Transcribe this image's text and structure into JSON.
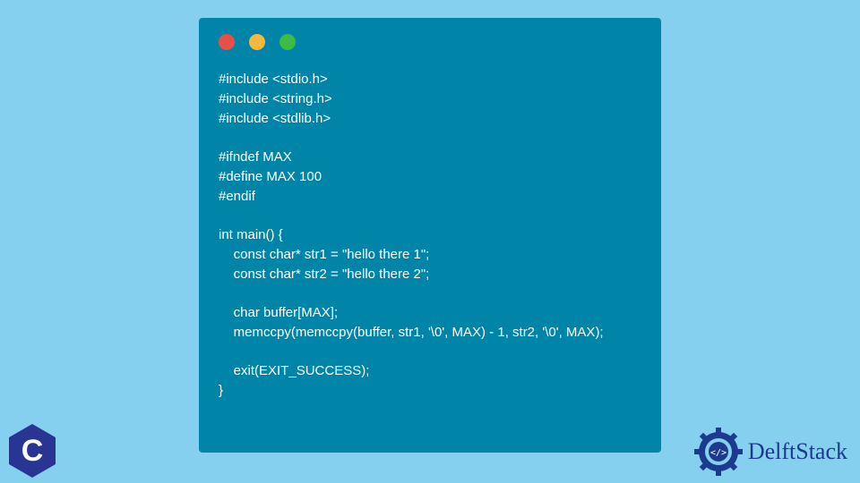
{
  "window": {
    "lights": {
      "red": "#e94f4a",
      "yellow": "#f5b83d",
      "green": "#3cbb45"
    }
  },
  "code": "#include <stdio.h>\n#include <string.h>\n#include <stdlib.h>\n\n#ifndef MAX\n#define MAX 100\n#endif\n\nint main() {\n    const char* str1 = \"hello there 1\";\n    const char* str2 = \"hello there 2\";\n\n    char buffer[MAX];\n    memccpy(memccpy(buffer, str1, '\\0', MAX) - 1, str2, '\\0', MAX);\n\n    exit(EXIT_SUCCESS);\n}",
  "logos": {
    "c_letter": "C",
    "delftstack": "DelftStack"
  }
}
